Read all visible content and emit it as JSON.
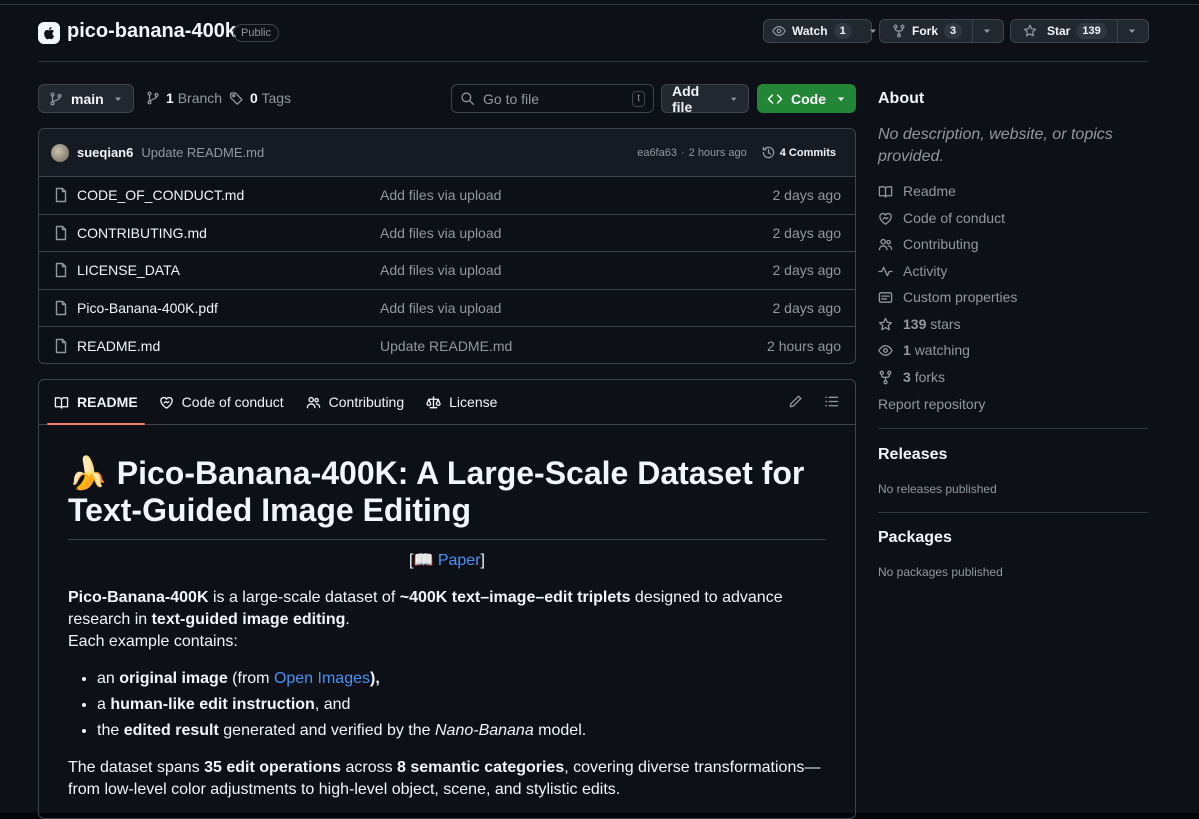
{
  "repo": {
    "name": "pico-banana-400k",
    "visibility": "Public"
  },
  "header_actions": {
    "watch_label": "Watch",
    "watch_count": "1",
    "fork_label": "Fork",
    "fork_count": "3",
    "star_label": "Star",
    "star_count": "139"
  },
  "toolbar": {
    "branch": "main",
    "branches_count": "1",
    "branches_label": "Branch",
    "tags_count": "0",
    "tags_label": "Tags",
    "search_placeholder": "Go to file",
    "search_shortcut": "t",
    "add_file_label": "Add file",
    "code_label": "Code"
  },
  "latest_commit": {
    "author": "sueqian6",
    "message": "Update README.md",
    "hash": "ea6fa63",
    "time": "2 hours ago",
    "commits_label": "4 Commits"
  },
  "files": [
    {
      "name": "CODE_OF_CONDUCT.md",
      "message": "Add files via upload",
      "date": "2 days ago"
    },
    {
      "name": "CONTRIBUTING.md",
      "message": "Add files via upload",
      "date": "2 days ago"
    },
    {
      "name": "LICENSE_DATA",
      "message": "Add files via upload",
      "date": "2 days ago"
    },
    {
      "name": "Pico-Banana-400K.pdf",
      "message": "Add files via upload",
      "date": "2 days ago"
    },
    {
      "name": "README.md",
      "message": "Update README.md",
      "date": "2 hours ago"
    }
  ],
  "readme_tabs": [
    {
      "label": "README",
      "icon": "book-icon"
    },
    {
      "label": "Code of conduct",
      "icon": "code-of-conduct-icon"
    },
    {
      "label": "Contributing",
      "icon": "people-icon"
    },
    {
      "label": "License",
      "icon": "law-icon"
    }
  ],
  "readme": {
    "title_emoji": "🍌",
    "title": "Pico-Banana-400K: A Large-Scale Dataset for Text-Guided Image Editing",
    "paper_open": "[",
    "paper_emoji": "📖",
    "paper_link": "Paper",
    "paper_close": "]",
    "intro": {
      "name": "Pico-Banana-400K",
      "t1": " is a large-scale dataset of ",
      "b1": "~400K text–image–edit triplets",
      "t2": " designed to advance research in ",
      "b2": "text-guided image editing",
      "t3": ".",
      "t4": "Each example contains:"
    },
    "bullets": [
      {
        "pre": "an ",
        "bold": "original image",
        "mid": " (from ",
        "link": "Open Images",
        "post": "),",
        "post_bold": true
      },
      {
        "pre": "a ",
        "bold": "human-like edit instruction",
        "post": ", and"
      },
      {
        "pre": "the ",
        "bold": "edited result",
        "mid": " generated and verified by the ",
        "italic": "Nano-Banana",
        "post": " model."
      }
    ],
    "summary": {
      "t1": "The dataset spans ",
      "b1": "35 edit operations",
      "t2": " across ",
      "b2": "8 semantic categories",
      "t3": ", covering diverse transformations—from low-level color adjustments to high-level object, scene, and stylistic edits."
    }
  },
  "about": {
    "heading": "About",
    "description": "No description, website, or topics provided.",
    "links": [
      {
        "icon": "book-icon",
        "label": "Readme"
      },
      {
        "icon": "code-of-conduct-icon",
        "label": "Code of conduct"
      },
      {
        "icon": "people-icon",
        "label": "Contributing"
      },
      {
        "icon": "pulse-icon",
        "label": "Activity"
      },
      {
        "icon": "properties-icon",
        "label": "Custom properties"
      },
      {
        "icon": "star-icon",
        "count": "139",
        "label": "stars"
      },
      {
        "icon": "eye-icon",
        "count": "1",
        "label": "watching"
      },
      {
        "icon": "fork-icon",
        "count": "3",
        "label": "forks"
      }
    ],
    "report": "Report repository"
  },
  "releases": {
    "heading": "Releases",
    "text": "No releases published"
  },
  "packages": {
    "heading": "Packages",
    "text": "No packages published"
  },
  "colors": {
    "accent_green": "#238636",
    "link_blue": "#4493f8",
    "tab_underline": "#f78166"
  }
}
